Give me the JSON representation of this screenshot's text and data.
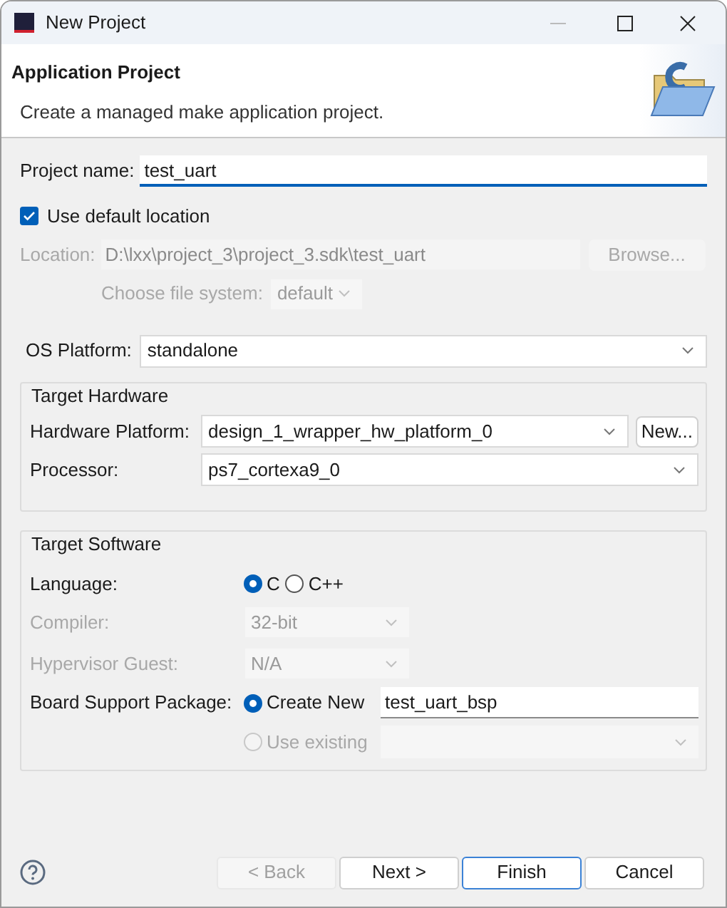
{
  "window": {
    "title": "New Project"
  },
  "header": {
    "title": "Application Project",
    "description": "Create a managed make application project."
  },
  "project_name": {
    "label": "Project name:",
    "value": "test_uart"
  },
  "use_default_location": {
    "label": "Use default location",
    "checked": true
  },
  "location": {
    "label": "Location:",
    "value": "D:\\lxx\\project_3\\project_3.sdk\\test_uart",
    "disabled": true
  },
  "browse_button": {
    "label": "Browse...",
    "disabled": true
  },
  "file_system": {
    "label": "Choose file system:",
    "value": "default",
    "disabled": true
  },
  "os_platform": {
    "label": "OS Platform:",
    "value": "standalone"
  },
  "target_hardware": {
    "title": "Target Hardware",
    "hardware_platform": {
      "label": "Hardware Platform:",
      "value": "design_1_wrapper_hw_platform_0"
    },
    "new_button": {
      "label": "New..."
    },
    "processor": {
      "label": "Processor:",
      "value": "ps7_cortexa9_0"
    }
  },
  "target_software": {
    "title": "Target Software",
    "language": {
      "label": "Language:",
      "options": [
        {
          "label": "C",
          "selected": true
        },
        {
          "label": "C++",
          "selected": false
        }
      ]
    },
    "compiler": {
      "label": "Compiler:",
      "value": "32-bit",
      "disabled": true
    },
    "hypervisor_guest": {
      "label": "Hypervisor Guest:",
      "value": "N/A",
      "disabled": true
    },
    "board_support_package": {
      "label": "Board Support Package:",
      "create_new": {
        "label": "Create New",
        "selected": true,
        "disabled": false
      },
      "bsp_name": {
        "value": "test_uart_bsp"
      },
      "use_existing": {
        "label": "Use existing",
        "selected": false,
        "disabled": true
      }
    }
  },
  "buttons": [
    {
      "label": "< Back",
      "disabled": true,
      "focused": false
    },
    {
      "label": "Next >",
      "disabled": false,
      "focused": false
    },
    {
      "label": "Finish",
      "disabled": false,
      "focused": true
    },
    {
      "label": "Cancel",
      "disabled": false,
      "focused": false
    }
  ]
}
